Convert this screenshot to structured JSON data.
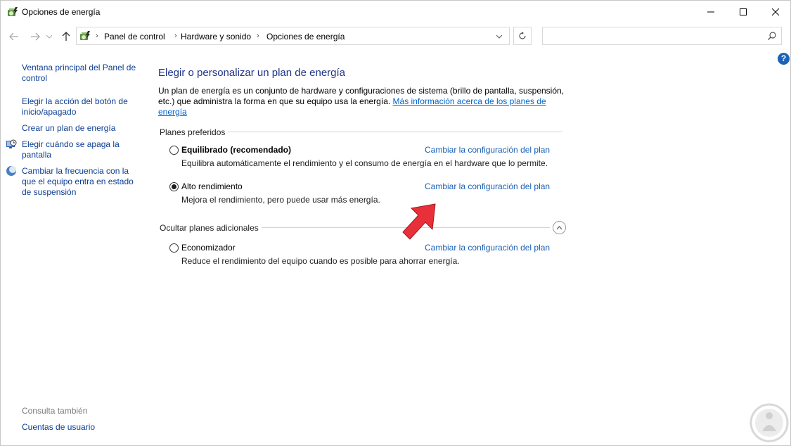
{
  "window": {
    "title": "Opciones de energía"
  },
  "address": {
    "crumbs": [
      "Panel de control",
      "Hardware y sonido",
      "Opciones de energía"
    ],
    "search_placeholder": ""
  },
  "help_label": "?",
  "left_pane": {
    "links": [
      {
        "label": "Ventana principal del Panel de control"
      },
      {
        "label": "Elegir la acción del botón de inicio/apagado"
      },
      {
        "label": "Crear un plan de energía"
      },
      {
        "label": "Elegir cuándo se apaga la pantalla",
        "icon": "clock-monitor-icon"
      },
      {
        "label": "Cambiar la frecuencia con la que el equipo entra en estado de suspensión",
        "icon": "moon-icon"
      }
    ],
    "see_also_title": "Consulta también",
    "see_also_links": [
      {
        "label": "Cuentas de usuario"
      }
    ]
  },
  "main": {
    "heading": "Elegir o personalizar un plan de energía",
    "intro_text": "Un plan de energía es un conjunto de hardware y configuraciones de sistema (brillo de pantalla, suspensión, etc.) que administra la forma en que su equipo usa la energía.",
    "intro_link": "Más información acerca de los planes de energía",
    "preferred_title": "Planes preferidos",
    "hidden_title": "Ocultar planes adicionales",
    "plans": [
      {
        "name": "Equilibrado (recomendado)",
        "bold": true,
        "selected": false,
        "desc": "Equilibra automáticamente el rendimiento y el consumo de energía en el hardware que lo permite.",
        "link": "Cambiar la configuración del plan"
      },
      {
        "name": "Alto rendimiento",
        "bold": false,
        "selected": true,
        "desc": "Mejora el rendimiento, pero puede usar más energía.",
        "link": "Cambiar la configuración del plan"
      },
      {
        "name": "Economizador",
        "bold": false,
        "selected": false,
        "desc": "Reduce el rendimiento del equipo cuando es posible para ahorrar energía.",
        "link": "Cambiar la configuración del plan"
      }
    ]
  },
  "colors": {
    "accent_blue": "#1a5fb4",
    "heading_blue": "#1e3287",
    "annotation_red": "#e8303a"
  }
}
